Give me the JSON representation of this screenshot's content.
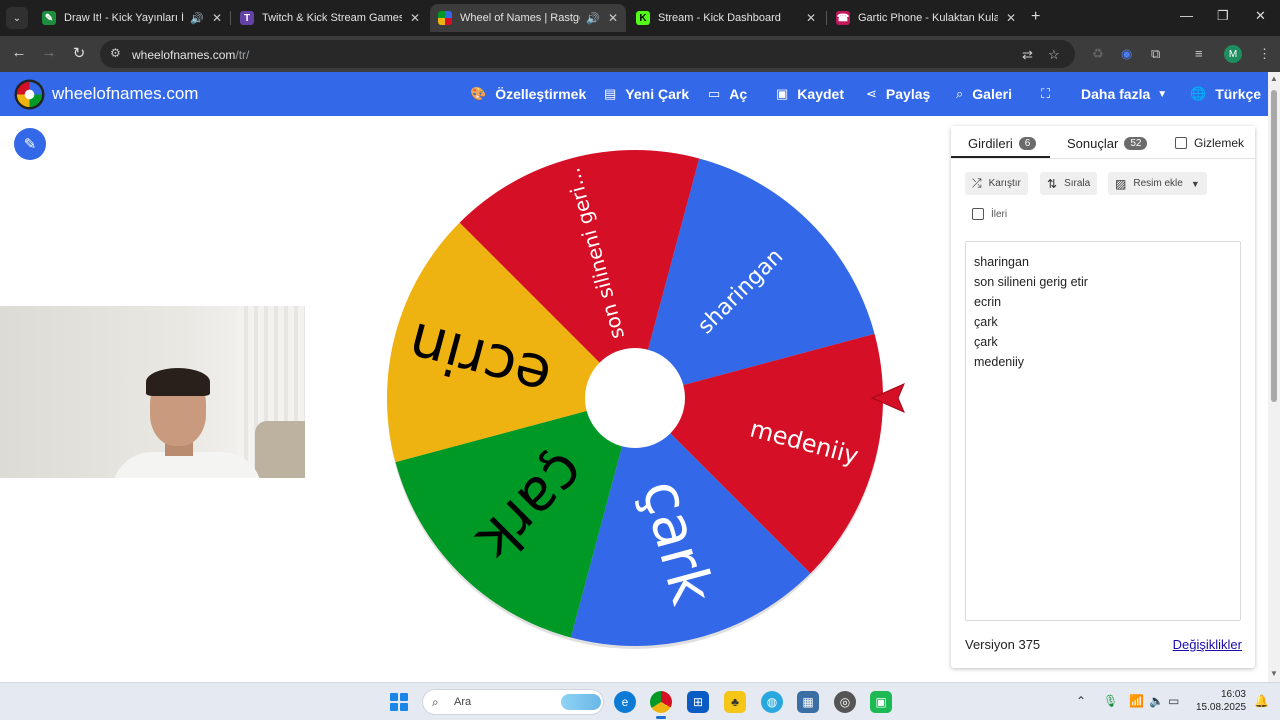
{
  "browser": {
    "tabs": [
      {
        "title": "Draw It! - Kick Yayınları İçin",
        "audio": "🔊",
        "favicon_color": "#1e8e3e",
        "favicon_glyph": "✎",
        "active": false
      },
      {
        "title": "Twitch & Kick Stream Games",
        "audio": "",
        "favicon_color": "#6441a5",
        "favicon_glyph": "T",
        "active": false
      },
      {
        "title": "Wheel of Names | Rastgele",
        "audio": "🔊",
        "favicon_color": "#3369e8",
        "favicon_glyph": "◉",
        "active": true
      },
      {
        "title": "Stream - Kick Dashboard",
        "audio": "",
        "favicon_color": "#53fc18",
        "favicon_glyph": "K",
        "active": false
      },
      {
        "title": "Gartic Phone - Kulaktan Kulağa",
        "audio": "",
        "favicon_color": "#c2185b",
        "favicon_glyph": "☎",
        "active": false
      }
    ],
    "url_host": "wheelofnames.com",
    "url_path": "/tr/",
    "profile_initial": "M"
  },
  "site": {
    "brand": "wheelofnames.com",
    "nav": {
      "customize": "Özelleştirmek",
      "new_wheel": "Yeni Çark",
      "open": "Aç",
      "save": "Kaydet",
      "share": "Paylaş",
      "gallery": "Galeri",
      "more": "Daha fazla",
      "language": "Türkçe"
    }
  },
  "wheel": {
    "segments": [
      {
        "label": "sharingan",
        "color": "#3369e8",
        "text_color": "#ffffff"
      },
      {
        "label": "medeniiy",
        "color": "#d50f25",
        "text_color": "#ffffff"
      },
      {
        "label": "çark",
        "color": "#3369e8",
        "text_color": "#ffffff"
      },
      {
        "label": "çark",
        "color": "#009925",
        "text_color": "#000000"
      },
      {
        "label": "ecrin",
        "color": "#eeb211",
        "text_color": "#000000"
      },
      {
        "label": "son silineni geri...",
        "color": "#d50f25",
        "text_color": "#ffffff"
      }
    ],
    "pointer_color": "#d50f25"
  },
  "panel": {
    "tab_entries": "Girdileri",
    "entries_count": "6",
    "tab_results": "Sonuçlar",
    "results_count": "52",
    "hide": "Gizlemek",
    "shuffle": "Karıştır",
    "sort": "Sırala",
    "add_image": "Resim ekle",
    "advanced": "İleri",
    "entries": [
      "sharingan",
      "son silineni gerig etir",
      "ecrin",
      "çark",
      "çark",
      "medeniiy"
    ],
    "version": "Versiyon 375",
    "changes": "Değişiklikler"
  },
  "taskbar": {
    "search_placeholder": "Ara",
    "time": "16:03",
    "date": "15.08.2025"
  }
}
